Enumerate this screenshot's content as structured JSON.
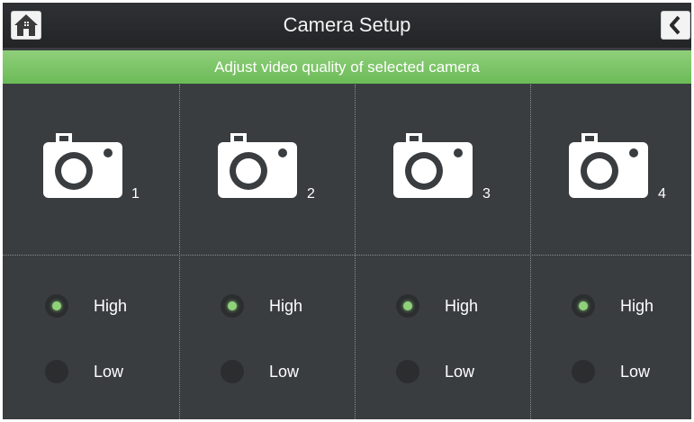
{
  "header": {
    "title": "Camera Setup",
    "home_icon": "home-icon",
    "back_icon": "chevron-left-icon"
  },
  "subtitle": "Adjust video quality of selected camera",
  "accent_color": "#6cbb57",
  "cameras": [
    {
      "number": "1",
      "options": [
        {
          "label": "High",
          "selected": true
        },
        {
          "label": "Low",
          "selected": false
        }
      ]
    },
    {
      "number": "2",
      "options": [
        {
          "label": "High",
          "selected": true
        },
        {
          "label": "Low",
          "selected": false
        }
      ]
    },
    {
      "number": "3",
      "options": [
        {
          "label": "High",
          "selected": true
        },
        {
          "label": "Low",
          "selected": false
        }
      ]
    },
    {
      "number": "4",
      "options": [
        {
          "label": "High",
          "selected": true
        },
        {
          "label": "Low",
          "selected": false
        }
      ]
    }
  ]
}
